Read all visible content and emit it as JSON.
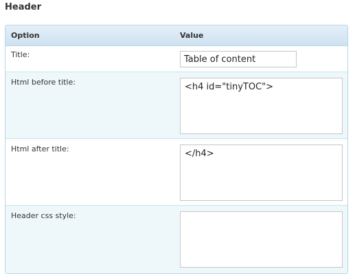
{
  "section": {
    "title": "Header"
  },
  "table": {
    "headers": {
      "option": "Option",
      "value": "Value"
    },
    "rows": [
      {
        "label": "Title:",
        "value": "Table of content"
      },
      {
        "label": "Html before title:",
        "value": "<h4 id=\"tinyTOC\">"
      },
      {
        "label": "Html after title:",
        "value": "</h4>"
      },
      {
        "label": "Header css style:",
        "value": ""
      }
    ]
  }
}
